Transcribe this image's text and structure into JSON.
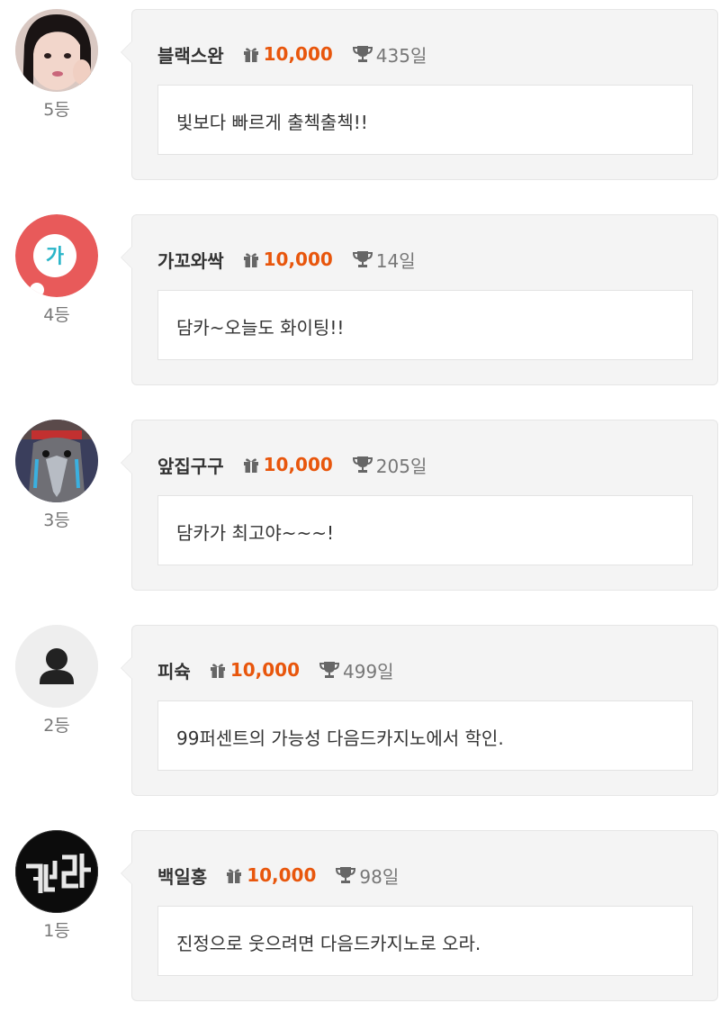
{
  "entries": [
    {
      "rank": "5등",
      "name": "블랙스완",
      "points": "10,000",
      "days": "435일",
      "message": "빛보다 빠르게 출첵출첵!!",
      "avatar_icon": "profile-photo"
    },
    {
      "rank": "4등",
      "name": "가꼬와싹",
      "points": "10,000",
      "days": "14일",
      "message": "담카~오늘도 화이팅!!",
      "avatar_icon": "ga-logo",
      "avatar_text": "가"
    },
    {
      "rank": "3등",
      "name": "앞집구구",
      "points": "10,000",
      "days": "205일",
      "message": "담카가 최고야~~~!",
      "avatar_icon": "bird-photo"
    },
    {
      "rank": "2등",
      "name": "피슉",
      "points": "10,000",
      "days": "499일",
      "message": "99퍼센트의 가능성 다음드카지노에서 학인.",
      "avatar_icon": "default-user-icon"
    },
    {
      "rank": "1등",
      "name": "백일홍",
      "points": "10,000",
      "days": "98일",
      "message": "진정으로 웃으려면 다음드카지노로 오라.",
      "avatar_icon": "neon-sign-photo"
    }
  ],
  "colors": {
    "points": "#e8560c",
    "card_bg": "#f4f4f4",
    "ga_logo_bg": "#e85a5a",
    "ga_logo_text": "#2ab5c8"
  }
}
